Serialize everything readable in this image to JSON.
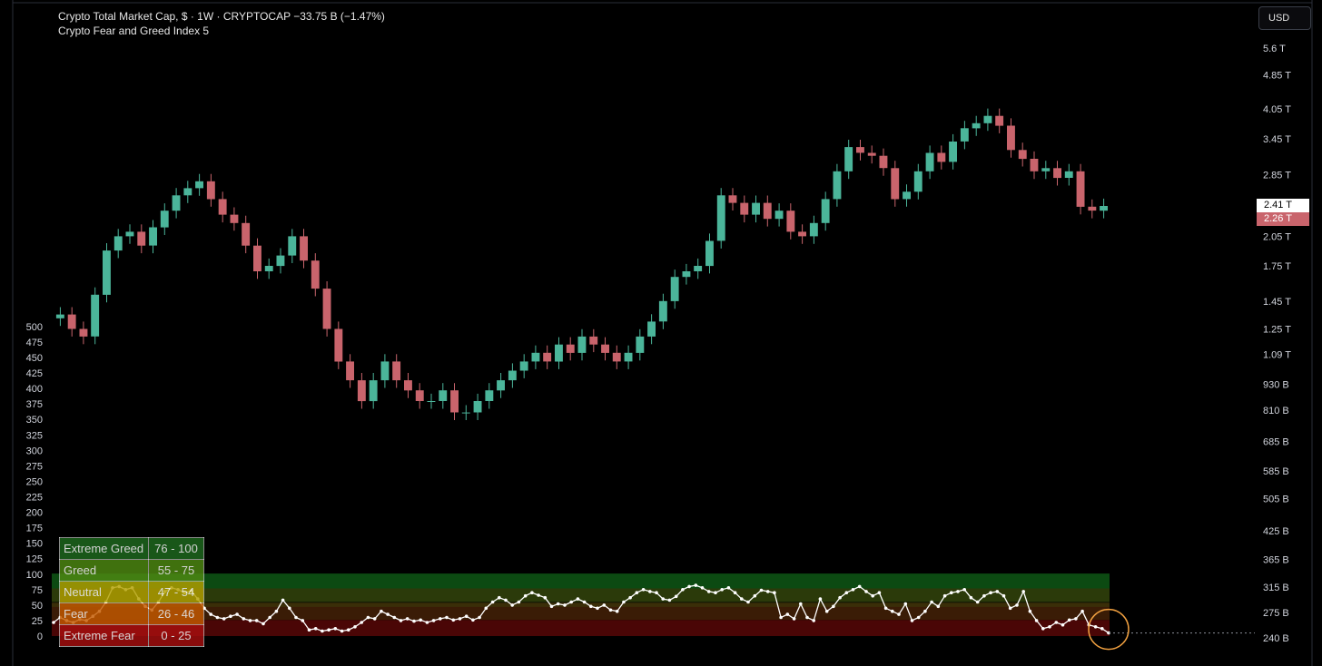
{
  "header": {
    "main_line": "Crypto Total Market Cap, $ · 1W · CRYPTOCAP  −33.75 B (−1.47%)",
    "sub_line": "Crypto Fear and Greed Index  5"
  },
  "currency_button": "USD",
  "price_tags": {
    "close": "2.41 T",
    "low": "2.26 T"
  },
  "left_axis_ticks": [
    "500",
    "475",
    "450",
    "425",
    "400",
    "375",
    "350",
    "325",
    "300",
    "275",
    "250",
    "225",
    "200",
    "175",
    "150",
    "125",
    "100",
    "75",
    "50",
    "25",
    "0"
  ],
  "right_axis_ticks": [
    "5.6 T",
    "4.85 T",
    "4.05 T",
    "3.45 T",
    "2.85 T",
    "2.05 T",
    "1.75 T",
    "1.45 T",
    "1.25 T",
    "1.09 T",
    "930 B",
    "810 B",
    "685 B",
    "585 B",
    "505 B",
    "425 B",
    "365 B",
    "315 B",
    "275 B",
    "240 B"
  ],
  "legend": [
    {
      "label": "Extreme Greed",
      "range": "76 - 100",
      "color": "#1f6b1f"
    },
    {
      "label": "Greed",
      "range": "55 - 75",
      "color": "#4f8a12"
    },
    {
      "label": "Neutral",
      "range": "47 - 54",
      "color": "#b3a000"
    },
    {
      "label": "Fear",
      "range": "26 - 46",
      "color": "#c45a00"
    },
    {
      "label": "Extreme Fear",
      "range": "0 - 25",
      "color": "#a80f0f"
    }
  ],
  "colors": {
    "up": "#4bb59a",
    "down": "#c9646c",
    "fg_line": "#ffffff",
    "highlight": "#f0a040"
  },
  "chart_data": [
    {
      "type": "candlestick",
      "title": "Crypto Total Market Cap, $ · 1W · CRYPTOCAP",
      "y_scale": "log",
      "y_unit": "USD",
      "approximate_weekly_closes_trillions": [
        1.35,
        1.25,
        1.2,
        1.5,
        1.9,
        2.05,
        2.1,
        1.95,
        2.15,
        2.35,
        2.55,
        2.65,
        2.75,
        2.5,
        2.3,
        2.2,
        1.95,
        1.7,
        1.75,
        1.85,
        2.05,
        1.8,
        1.55,
        1.25,
        1.05,
        0.95,
        0.85,
        0.95,
        1.05,
        0.95,
        0.9,
        0.85,
        0.85,
        0.9,
        0.8,
        0.8,
        0.85,
        0.9,
        0.95,
        1.0,
        1.05,
        1.1,
        1.05,
        1.15,
        1.1,
        1.2,
        1.15,
        1.1,
        1.05,
        1.1,
        1.2,
        1.3,
        1.45,
        1.65,
        1.7,
        1.75,
        2.0,
        2.55,
        2.45,
        2.3,
        2.45,
        2.25,
        2.35,
        2.1,
        2.05,
        2.2,
        2.5,
        2.9,
        3.3,
        3.2,
        3.15,
        2.95,
        2.5,
        2.6,
        2.9,
        3.2,
        3.05,
        3.4,
        3.65,
        3.75,
        3.9,
        3.7,
        3.25,
        3.1,
        2.9,
        2.95,
        2.8,
        2.9,
        2.4,
        2.35,
        2.41
      ],
      "last_close": "2.41 T",
      "last_change": "−33.75 B (−1.47%)"
    },
    {
      "type": "line",
      "title": "Crypto Fear and Greed Index",
      "ylim": [
        0,
        100
      ],
      "last_value": 5,
      "zones": [
        {
          "label": "Extreme Greed",
          "range": [
            76,
            100
          ]
        },
        {
          "label": "Greed",
          "range": [
            55,
            75
          ]
        },
        {
          "label": "Neutral",
          "range": [
            47,
            54
          ]
        },
        {
          "label": "Fear",
          "range": [
            26,
            46
          ]
        },
        {
          "label": "Extreme Fear",
          "range": [
            0,
            25
          ]
        }
      ],
      "values": [
        22,
        30,
        25,
        22,
        27,
        25,
        32,
        40,
        55,
        78,
        80,
        75,
        78,
        60,
        48,
        42,
        55,
        72,
        78,
        75,
        70,
        73,
        60,
        45,
        35,
        30,
        28,
        32,
        35,
        28,
        25,
        25,
        20,
        30,
        40,
        58,
        45,
        30,
        25,
        10,
        12,
        8,
        10,
        12,
        8,
        10,
        15,
        22,
        30,
        28,
        40,
        35,
        30,
        25,
        28,
        24,
        26,
        22,
        25,
        28,
        30,
        26,
        28,
        32,
        26,
        30,
        45,
        55,
        62,
        58,
        50,
        55,
        65,
        70,
        66,
        62,
        48,
        52,
        50,
        55,
        60,
        55,
        48,
        45,
        50,
        42,
        40,
        55,
        62,
        70,
        75,
        72,
        70,
        60,
        58,
        64,
        75,
        80,
        82,
        78,
        72,
        70,
        75,
        78,
        70,
        60,
        55,
        65,
        74,
        72,
        70,
        30,
        35,
        28,
        52,
        30,
        25,
        60,
        40,
        48,
        62,
        70,
        75,
        80,
        72,
        65,
        70,
        45,
        40,
        35,
        52,
        25,
        30,
        40,
        55,
        48,
        65,
        70,
        72,
        75,
        62,
        55,
        65,
        70,
        72,
        65,
        45,
        50,
        72,
        40,
        25,
        12,
        15,
        22,
        18,
        26,
        28,
        40,
        18,
        15,
        12,
        5
      ]
    }
  ]
}
